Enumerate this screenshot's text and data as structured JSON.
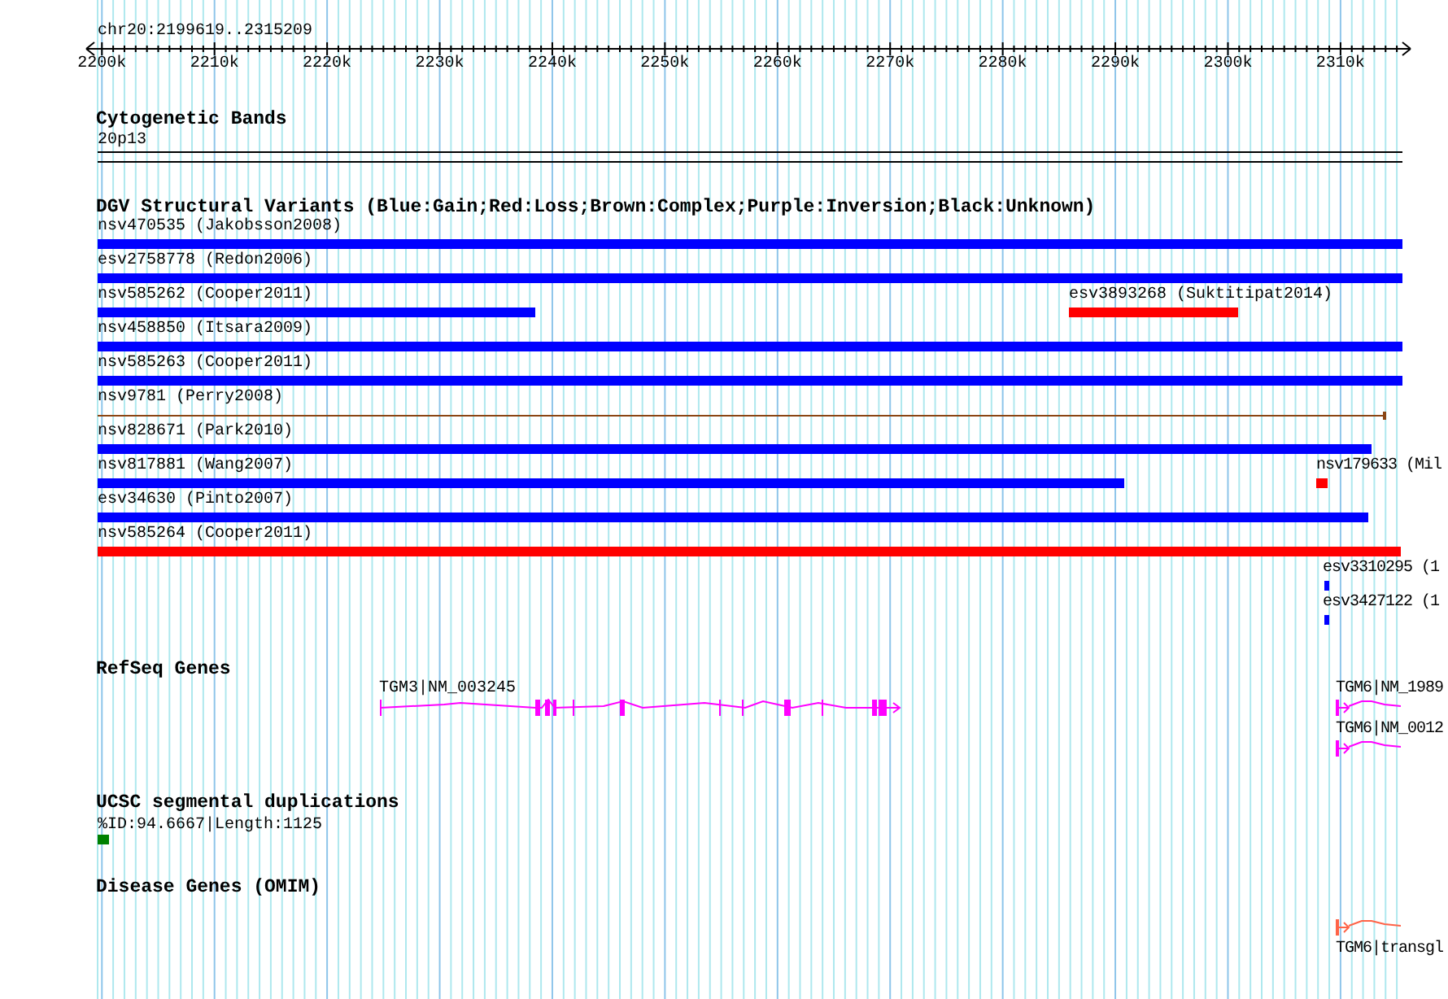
{
  "ruler": {
    "location": "chr20:2199619..2315209",
    "ticks": [
      "2200k",
      "2210k",
      "2220k",
      "2230k",
      "2240k",
      "2250k",
      "2260k",
      "2270k",
      "2280k",
      "2290k",
      "2300k",
      "2310k"
    ]
  },
  "cytogenetic": {
    "title": "Cytogenetic Bands",
    "band": "20p13"
  },
  "dgv": {
    "title": "DGV Structural Variants (Blue:Gain;Red:Loss;Brown:Complex;Purple:Inversion;Black:Unknown)",
    "rows": [
      {
        "features": [
          {
            "label": "nsv470535 (Jakobsson2008)",
            "kind": "gain"
          }
        ]
      },
      {
        "features": [
          {
            "label": "esv2758778 (Redon2006)",
            "kind": "gain"
          }
        ]
      },
      {
        "features": [
          {
            "label": "nsv585262 (Cooper2011)",
            "kind": "gain"
          },
          {
            "label": "esv3893268 (Suktitipat2014)",
            "kind": "loss"
          }
        ]
      },
      {
        "features": [
          {
            "label": "nsv458850 (Itsara2009)",
            "kind": "gain"
          }
        ]
      },
      {
        "features": [
          {
            "label": "nsv585263 (Cooper2011)",
            "kind": "gain"
          }
        ]
      },
      {
        "features": [
          {
            "label": "nsv9781 (Perry2008)",
            "kind": "complex"
          }
        ]
      },
      {
        "features": [
          {
            "label": "nsv828671 (Park2010)",
            "kind": "gain"
          }
        ]
      },
      {
        "features": [
          {
            "label": "nsv817881 (Wang2007)",
            "kind": "gain"
          },
          {
            "label": "nsv179633 (Mil",
            "kind": "loss"
          }
        ]
      },
      {
        "features": [
          {
            "label": "esv34630 (Pinto2007)",
            "kind": "gain"
          }
        ]
      },
      {
        "features": [
          {
            "label": "nsv585264 (Cooper2011)",
            "kind": "loss"
          }
        ]
      },
      {
        "features": [
          {
            "label": "esv3310295 (1",
            "kind": "gain"
          }
        ]
      },
      {
        "features": [
          {
            "label": "esv3427122 (1",
            "kind": "gain"
          }
        ]
      }
    ]
  },
  "refseq": {
    "title": "RefSeq Genes",
    "genes": [
      {
        "label": "TGM3|NM_003245"
      },
      {
        "label": "TGM6|NM_1989"
      },
      {
        "label": "TGM6|NM_0012"
      }
    ]
  },
  "segdups": {
    "title": "UCSC segmental duplications",
    "label": "%ID:94.6667|Length:1125"
  },
  "omim": {
    "title": "Disease Genes (OMIM)",
    "genes": [
      {
        "label": "TGM6|transgl"
      }
    ]
  }
}
